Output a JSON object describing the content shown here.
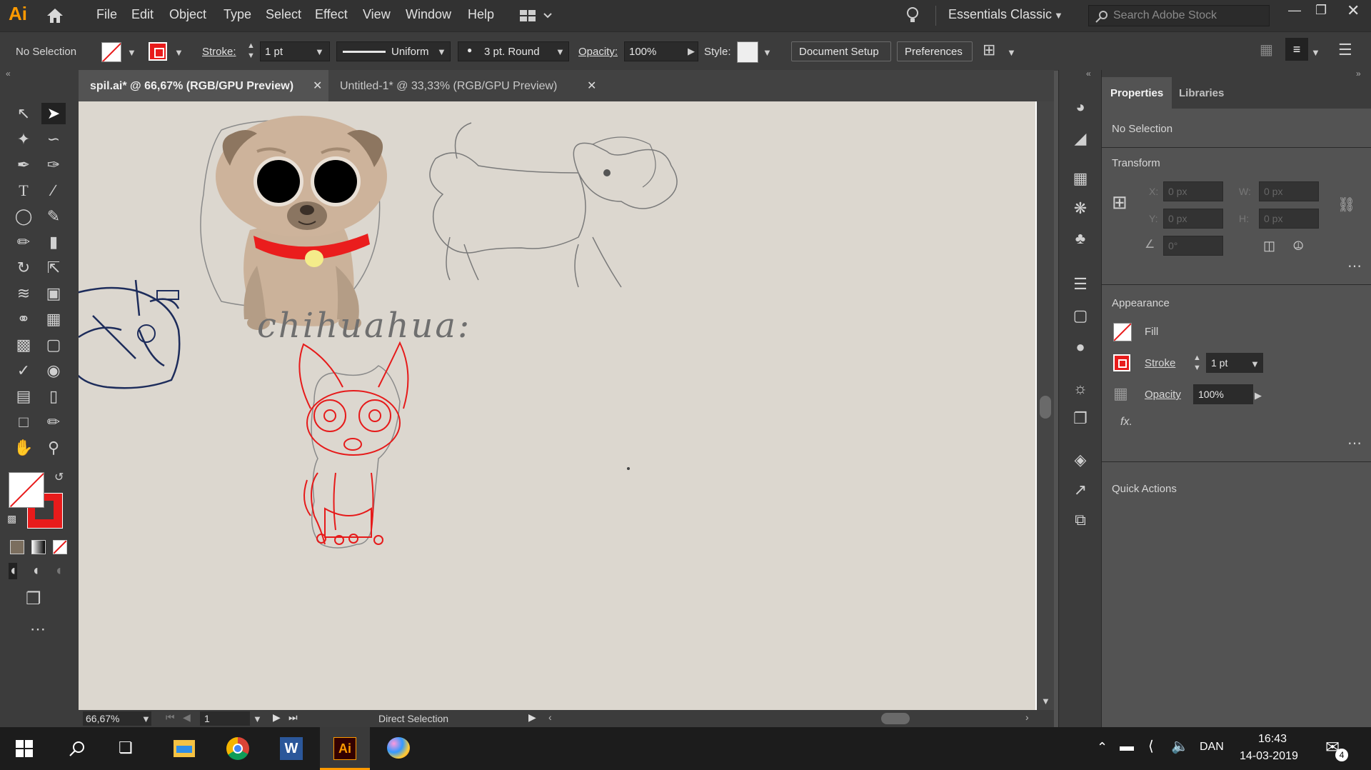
{
  "app": {
    "logo": "Ai",
    "home_icon": "home-icon",
    "workspace": "Essentials Classic",
    "search_placeholder": "Search Adobe Stock"
  },
  "menu": [
    "File",
    "Edit",
    "Object",
    "Type",
    "Select",
    "Effect",
    "View",
    "Window",
    "Help"
  ],
  "control": {
    "selection": "No Selection",
    "stroke_label": "Stroke:",
    "stroke_value": "1 pt",
    "profile": "Uniform",
    "brush": "3 pt. Round",
    "opacity_label": "Opacity:",
    "opacity_value": "100%",
    "style_label": "Style:",
    "doc_setup": "Document Setup",
    "preferences": "Preferences"
  },
  "tabs": [
    {
      "label": "spil.ai* @ 66,67% (RGB/GPU Preview)",
      "active": true
    },
    {
      "label": "Untitled-1* @ 33,33% (RGB/GPU Preview)",
      "active": false
    }
  ],
  "canvas": {
    "sketch_text": "chihuahua:"
  },
  "status": {
    "zoom": "66,67%",
    "artboard": "1",
    "tool": "Direct Selection"
  },
  "panel": {
    "tabs": [
      "Properties",
      "Libraries"
    ],
    "selection": "No Selection",
    "transform_title": "Transform",
    "x_label": "X:",
    "x_value": "0 px",
    "y_label": "Y:",
    "y_value": "0 px",
    "w_label": "W:",
    "w_value": "0 px",
    "h_label": "H:",
    "h_value": "0 px",
    "angle_value": "0°",
    "appearance_title": "Appearance",
    "fill_label": "Fill",
    "stroke_label": "Stroke",
    "stroke_value": "1 pt",
    "opacity_label": "Opacity",
    "opacity_value": "100%",
    "fx_label": "fx.",
    "quick_actions": "Quick Actions"
  },
  "colors": {
    "fill_none": "#ffffff",
    "stroke": "#e81b1b",
    "accent": "#ff9a00"
  },
  "taskbar": {
    "apps": [
      "start-icon",
      "search-icon",
      "task-view-icon",
      "file-explorer-icon",
      "chrome-icon",
      "word-icon",
      "illustrator-icon",
      "paint-icon"
    ],
    "language": "DAN",
    "time": "16:43",
    "date": "14-03-2019",
    "notifications": "4"
  }
}
